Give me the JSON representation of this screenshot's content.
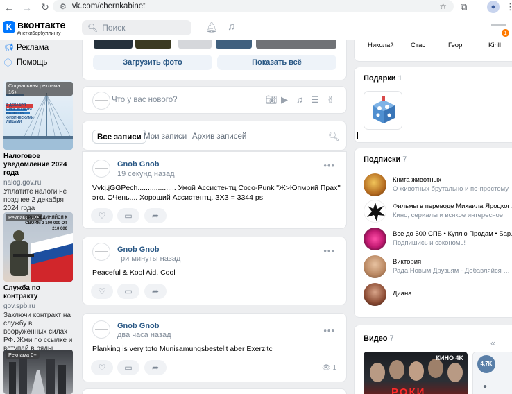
{
  "browser": {
    "url": "vk.com/chernkabinet"
  },
  "header": {
    "brand": "вконтакте",
    "tagline": "#нетки6ербуллингу",
    "search_placeholder": "Поиск",
    "notif_count": "1"
  },
  "left_menu": {
    "items": [
      {
        "label": "Реклама",
        "icon": "megaphone-icon"
      },
      {
        "label": "Помощь",
        "icon": "help-icon"
      }
    ]
  },
  "ads": [
    {
      "badge": "Социальная реклама 16+",
      "image_caption": "2 ДЕКАБРЯ — СРОК УПЛАТЫ НАЛОГОВ ФИЗИЧЕСКИМИ ЛИЦАМИ",
      "title": "Налоговое уведомление 2024 года",
      "domain": "nalog.gov.ru",
      "desc": "Уплатите налоги не позднее 2 декабря 2024 года"
    },
    {
      "badge": "Реклама 18+",
      "image_caption": "ПРИСОЕДИНЯЙСЯ К СВОИМ 2 100 000 ОТ 210 000",
      "title": "Служба по контракту",
      "domain": "gov.spb.ru",
      "desc": "Заключи контракт на службу в вооруженных силах РФ. Жми по ссылке и вступай в ряды Героев!"
    },
    {
      "badge": "Реклама 0+"
    }
  ],
  "photos": {
    "upload_label": "Загрузить фото",
    "show_all_label": "Показать всё"
  },
  "compose": {
    "placeholder": "Что у вас нового?"
  },
  "wall_tabs": [
    {
      "label": "Все записи",
      "active": true
    },
    {
      "label": "Мои записи",
      "active": false
    },
    {
      "label": "Архив записей",
      "active": false
    }
  ],
  "posts": [
    {
      "author": "Gnob Gnob",
      "time": "19 секунд назад",
      "text": "Vvkj.jGGPech................... Умой Ассистентц Coco-Punk \"Ж>Юпмрий Прах'\" это. ОЧень.... Хороший Ассистентц. ЗХЗ = 3344 ps",
      "views": ""
    },
    {
      "author": "Gnob Gnob",
      "time": "три минуты назад",
      "text": "Peaceful & Kool Aid. Cool",
      "views": ""
    },
    {
      "author": "Gnob Gnob",
      "time": "два часа назад",
      "text": "Planking is very toto Munisamungsbestellt aber Exerzitc",
      "views": "1"
    }
  ],
  "friends": {
    "names": [
      "Николай",
      "Стас",
      "Георг",
      "Kirill"
    ]
  },
  "gifts": {
    "title": "Подарки",
    "count": "1"
  },
  "subscriptions": {
    "title": "Подписки",
    "count": "7",
    "items": [
      {
        "name": "Книга животных",
        "desc": "О животных брутально и по-простому"
      },
      {
        "name": "Фильмы в переводе Михаила Яроцког…",
        "desc": "Кино, сериалы и всякое интересное"
      },
      {
        "name": "Все до 500 СПБ • Куплю Продам • Бар…",
        "desc": "Подпишись и сэкономь!"
      },
      {
        "name": "Виктория",
        "desc": "Рада Новым Друзьям - Добавляйся …"
      },
      {
        "name": "Диана",
        "desc": ""
      }
    ]
  },
  "videos": {
    "title": "Видео",
    "count": "7",
    "thumb_label": "КИНО 4K",
    "thumb_text": "РОКИ",
    "views_badge": "4,7K"
  },
  "colors": {
    "accent": "#0077ff",
    "link": "#2a5885",
    "bg": "#edeef0"
  }
}
